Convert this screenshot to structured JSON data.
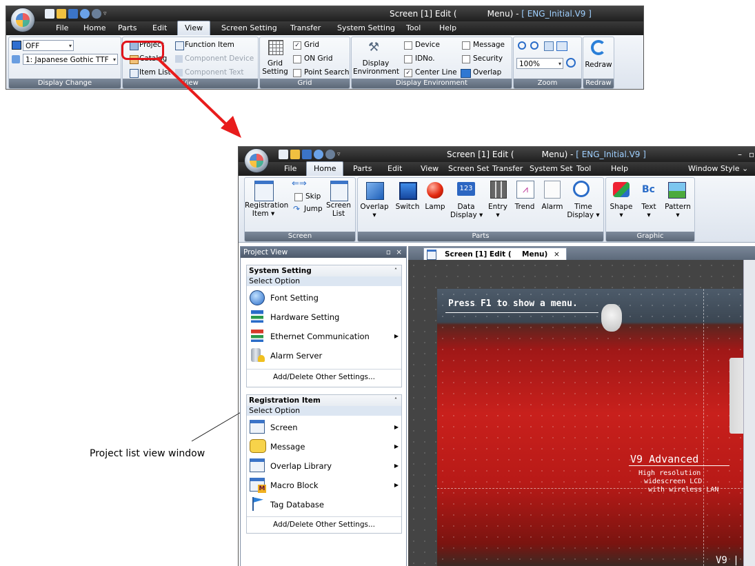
{
  "top_window": {
    "title_left": "Screen [1] Edit (",
    "title_mid": "Menu) - ",
    "title_file": "[ ENG_Initial.V9 ]",
    "tabs": [
      "File",
      "Home",
      "Parts",
      "Edit",
      "View",
      "Screen Setting",
      "Transfer",
      "System Setting",
      "Tool",
      "Help"
    ],
    "active_tab": "View",
    "display_change": {
      "combo1": "OFF",
      "combo2": "1: Japanese Gothic TTF",
      "label": "Display Change"
    },
    "view_group": {
      "project": "Project",
      "catalog": "Catalog",
      "item_list": "Item List",
      "function_item": "Function Item",
      "component_device": "Component Device",
      "component_text": "Component Text",
      "label": "View"
    },
    "grid_group": {
      "grid_setting_1": "Grid",
      "grid_setting_2": "Setting",
      "grid": "Grid",
      "on_grid": "ON Grid",
      "point_search": "Point Search",
      "label": "Grid",
      "grid_checked": "✓"
    },
    "display_env": {
      "display_env_1": "Display",
      "display_env_2": "Environment",
      "device": "Device",
      "idno": "IDNo.",
      "center_line": "Center Line",
      "message": "Message",
      "security": "Security",
      "overlap": "Overlap",
      "center_checked": "✓",
      "label": "Display Environment"
    },
    "zoom": {
      "value": "100%",
      "label": "Zoom"
    },
    "redraw": {
      "button": "Redraw",
      "label": "Redraw"
    }
  },
  "bottom_window": {
    "title_left": "Screen [1] Edit (",
    "title_mid": "Menu) - ",
    "title_file": "[ ENG_Initial.V9 ]",
    "tabs": [
      "File",
      "Home",
      "Parts",
      "Edit",
      "View",
      "Screen Set",
      "Transfer",
      "System Set",
      "Tool",
      "Help"
    ],
    "active_tab": "Home",
    "window_style": "Window Style",
    "screen_group": {
      "registration_1": "Registration",
      "registration_2": "Item",
      "skip": "Skip",
      "jump": "Jump",
      "screen_list_1": "Screen",
      "screen_list_2": "List",
      "label": "Screen"
    },
    "parts_group": {
      "overlap": "Overlap",
      "switch": "Switch",
      "lamp": "Lamp",
      "data_display_1": "Data",
      "data_display_2": "Display",
      "entry": "Entry",
      "trend": "Trend",
      "alarm": "Alarm",
      "time_display_1": "Time",
      "time_display_2": "Display",
      "label": "Parts"
    },
    "graphic_group": {
      "shape": "Shape",
      "text": "Text",
      "pattern": "Pattern",
      "label": "Graphic"
    },
    "project_view": {
      "title": "Project View",
      "system_setting": {
        "title": "System Setting",
        "select_option": "Select Option",
        "items": [
          "Font Setting",
          "Hardware Setting",
          "Ethernet Communication",
          "Alarm Server"
        ],
        "add_delete": "Add/Delete Other Settings..."
      },
      "registration_item": {
        "title": "Registration Item",
        "select_option": "Select Option",
        "items": [
          "Screen",
          "Message",
          "Overlap Library",
          "Macro Block",
          "Tag Database"
        ],
        "add_delete": "Add/Delete Other Settings..."
      }
    },
    "editor_tab": {
      "left": "Screen [1] Edit (",
      "right": "Menu)",
      "close": "×"
    },
    "canvas": {
      "press_f1": "Press F1 to show a menu.",
      "model": "V9 Advanced",
      "line1": "High resolution",
      "line2": "widescreen LCD",
      "line3": "with wireless LAN",
      "corner": "V9 |"
    }
  },
  "annotation": {
    "callout": "Project list view window"
  },
  "colors": {
    "highlight_red": "#e0141b",
    "arrow_red": "#e81c1c"
  }
}
